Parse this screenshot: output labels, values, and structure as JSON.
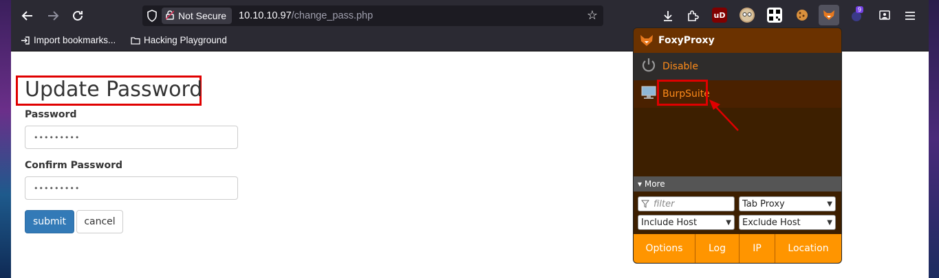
{
  "toolbar": {
    "security_label": "Not Secure",
    "url_host": "10.10.10.97",
    "url_path": "/change_pass.php",
    "notification_badge": "9"
  },
  "bookmarks": [
    {
      "label": "Import bookmarks...",
      "icon": "import-icon"
    },
    {
      "label": "Hacking Playground",
      "icon": "folder-icon"
    }
  ],
  "page": {
    "title": "Update Password",
    "password_label": "Password",
    "password_value": "•••••••••",
    "confirm_label": "Confirm Password",
    "confirm_value": "•••••••••",
    "submit_label": "submit",
    "cancel_label": "cancel"
  },
  "foxyproxy": {
    "title": "FoxyProxy",
    "items": [
      {
        "label": "Disable",
        "icon": "power-icon"
      },
      {
        "label": "BurpSuite",
        "icon": "monitor-icon"
      }
    ],
    "more_label": "▾ More",
    "filter_placeholder": "filter",
    "tab_proxy": "Tab Proxy",
    "include_host": "Include Host",
    "exclude_host": "Exclude Host",
    "buttons": [
      "Options",
      "Log",
      "IP",
      "Location"
    ]
  },
  "colors": {
    "annotation": "#e00000",
    "accent_orange": "#ff9500",
    "submit_blue": "#337ab7"
  }
}
